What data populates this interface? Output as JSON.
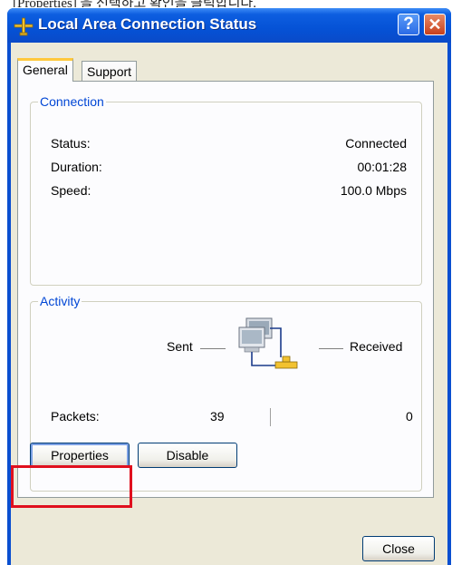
{
  "caption_fragment": "[Properties] 을 선택하고 확인을 클릭합니다.",
  "window": {
    "title": "Local Area Connection Status",
    "help_glyph": "?",
    "close_glyph": "✕",
    "icon": "network-connection-icon"
  },
  "tabs": [
    {
      "label": "General",
      "selected": true
    },
    {
      "label": "Support",
      "selected": false
    }
  ],
  "connection": {
    "legend": "Connection",
    "rows": [
      {
        "label": "Status:",
        "value": "Connected"
      },
      {
        "label": "Duration:",
        "value": "00:01:28"
      },
      {
        "label": "Speed:",
        "value": "100.0 Mbps"
      }
    ]
  },
  "activity": {
    "legend": "Activity",
    "sent_label": "Sent",
    "received_label": "Received",
    "packets_label": "Packets:",
    "packets_sent": "39",
    "packets_received": "0",
    "icon": "network-computers-icon"
  },
  "buttons": {
    "properties": "Properties",
    "disable": "Disable",
    "close": "Close"
  },
  "colors": {
    "title_bar": "#0552d6",
    "group_legend": "#0046d5",
    "highlight": "#e0101e",
    "dialog_face": "#ece9d8"
  }
}
